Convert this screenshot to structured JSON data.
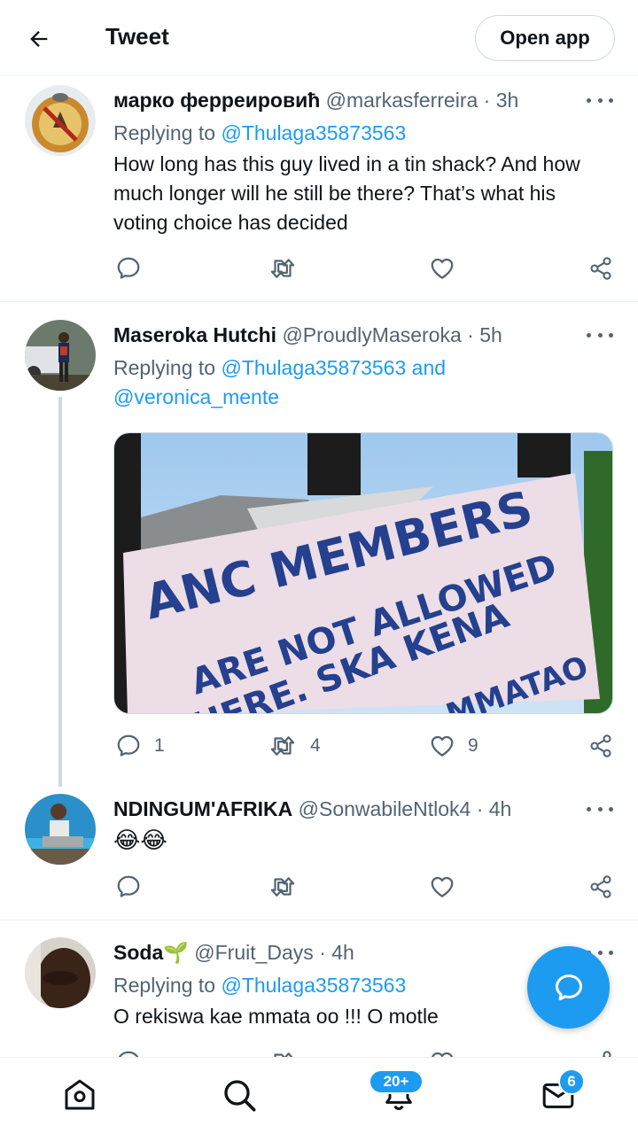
{
  "header": {
    "title": "Tweet",
    "open_app_label": "Open app",
    "back_icon": "arrow-left-icon"
  },
  "tweets": [
    {
      "name": "марко ферреировић",
      "handle": "@markasferreira",
      "time": "3h",
      "replying_prefix": "Replying to",
      "replying_to": "@Thulaga35873563",
      "text": "How long has this guy lived in a tin shack? And how much longer will he still be there? That’s what his voting choice has decided",
      "reply_count": "",
      "retweet_count": "",
      "like_count": ""
    },
    {
      "name": "Maseroka Hutchi",
      "handle": "@ProudlyMaseroka",
      "time": "5h",
      "replying_prefix": "Replying to",
      "replying_to": "@Thulaga35873563 and",
      "replying_to_2": "@veronica_mente",
      "media_text": [
        "ANC MEMBERS",
        "ARE NOT ALLOWED",
        "HERE. SKA KENA",
        "MMATAO"
      ],
      "reply_count": "1",
      "retweet_count": "4",
      "like_count": "9"
    },
    {
      "name": "NDINGUM'AFRIKA",
      "handle": "@SonwabileNtlok4",
      "time": "4h",
      "text": "😂😂",
      "reply_count": "",
      "retweet_count": "",
      "like_count": ""
    },
    {
      "name": "Soda",
      "name_emoji": "🌱",
      "handle": "@Fruit_Days",
      "time": "4h",
      "replying_prefix": "Replying to",
      "replying_to": "@Thulaga35873563",
      "text": "O rekiswa kae mmata oo !!! O motle"
    }
  ],
  "separator": "·",
  "bottom_nav": {
    "home_icon": "home-icon",
    "search_icon": "search-icon",
    "notifications_icon": "bell-icon",
    "notifications_badge": "20+",
    "messages_icon": "envelope-icon",
    "messages_badge": "6"
  },
  "colors": {
    "accent": "#1d9bf0",
    "text": "#0f1419",
    "secondary": "#536471",
    "border": "#eff3f4"
  }
}
